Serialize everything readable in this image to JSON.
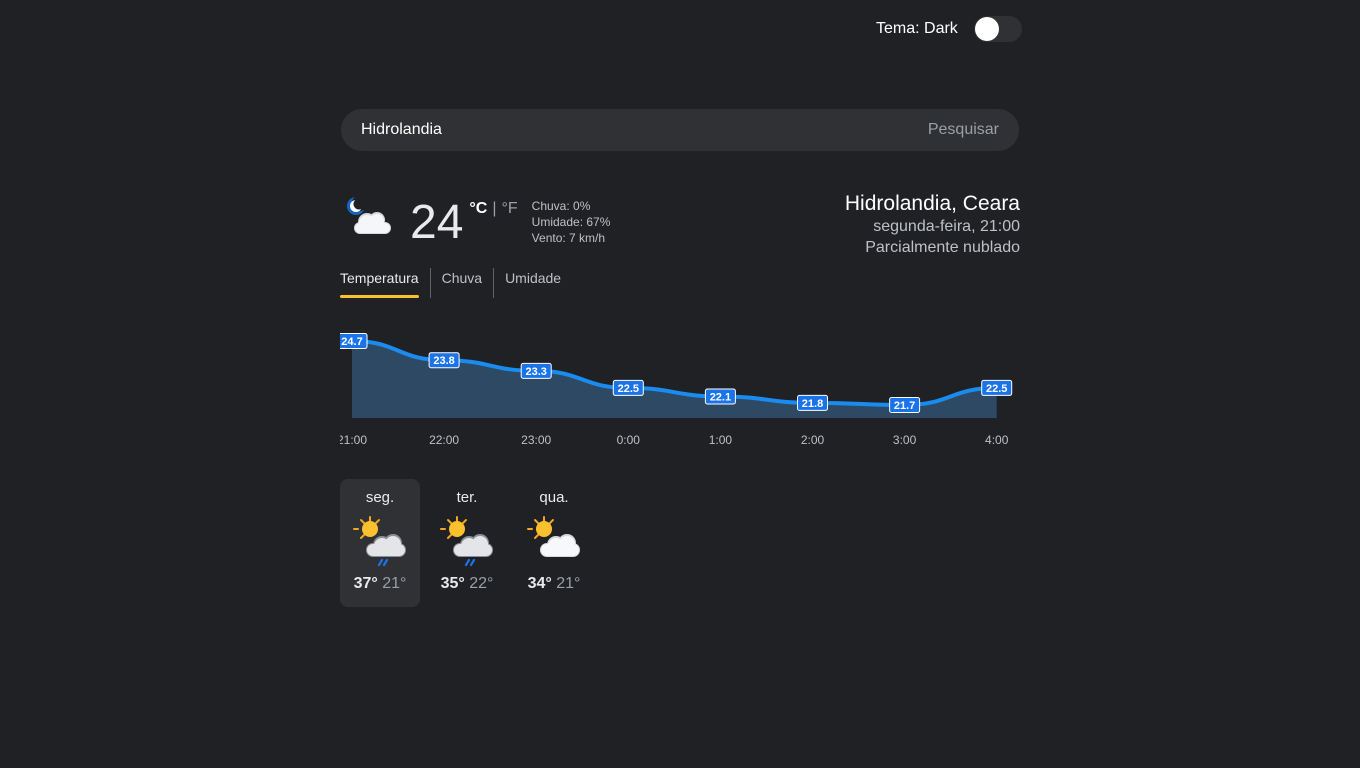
{
  "theme": {
    "label": "Tema: Dark"
  },
  "search": {
    "value": "Hidrolandia",
    "button_label": "Pesquisar"
  },
  "current": {
    "icon": "partly-cloudy-night-icon",
    "temperature": "24",
    "unit_c": "°C",
    "unit_sep": "|",
    "unit_f": "°F",
    "rain": "Chuva: 0%",
    "humidity": "Umidade: 67%",
    "wind": "Vento: 7 km/h"
  },
  "location": {
    "name": "Hidrolandia, Ceara",
    "datetime": "segunda-feira, 21:00",
    "condition": "Parcialmente nublado"
  },
  "tabs": [
    {
      "label": "Temperatura",
      "active": true
    },
    {
      "label": "Chuva",
      "active": false
    },
    {
      "label": "Umidade",
      "active": false
    }
  ],
  "chart_data": {
    "type": "area",
    "categories": [
      "21:00",
      "22:00",
      "23:00",
      "0:00",
      "1:00",
      "2:00",
      "3:00",
      "4:00"
    ],
    "values": [
      24.7,
      23.8,
      23.3,
      22.5,
      22.1,
      21.8,
      21.7,
      22.5
    ],
    "line_color": "#1a8cf0",
    "fill_color": "#2d4964"
  },
  "forecast": [
    {
      "day": "seg.",
      "icon": "sun-cloud-rain-icon",
      "max": "37°",
      "min": "21°",
      "selected": true
    },
    {
      "day": "ter.",
      "icon": "sun-cloud-rain-icon",
      "max": "35°",
      "min": "22°",
      "selected": false
    },
    {
      "day": "qua.",
      "icon": "sun-cloud-icon",
      "max": "34°",
      "min": "21°",
      "selected": false
    }
  ]
}
